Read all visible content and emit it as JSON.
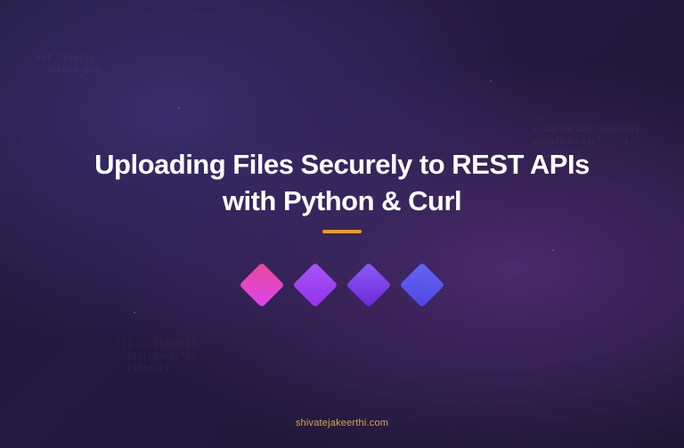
{
  "title_line1": "Uploading Files Securely to REST APIs",
  "title_line2": "with Python & Curl",
  "footer_text": "shivatejakeerthi.com",
  "code_snippet_1": "def file();\n  return int\n",
  "code_snippet_2": "# Authorize commands\nauthfederal('...')\n  print()\n",
  "code_snippet_3": "(() => items())\n  list(path(*))\n  filter()\n",
  "colors": {
    "diamond1": "#ec4899",
    "diamond2": "#a855f7",
    "diamond3": "#8b5cf6",
    "diamond4": "#6366f1",
    "accent": "#f59e0b",
    "footer": "#d4a94e"
  }
}
